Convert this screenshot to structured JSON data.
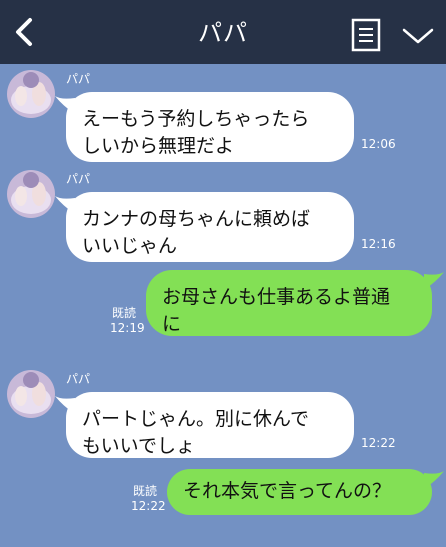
{
  "header": {
    "title": "パパ",
    "background": "#263146"
  },
  "colors": {
    "chat_background": "#7391c3",
    "incoming_bubble": "#ffffff",
    "outgoing_bubble": "#83e055"
  },
  "messages": [
    {
      "direction": "incoming",
      "sender": "パパ",
      "lines": [
        "えーもう予約しちゃったら",
        "しいから無理だよ"
      ],
      "time": "12:06"
    },
    {
      "direction": "incoming",
      "sender": "パパ",
      "lines": [
        "カンナの母ちゃんに頼めば",
        "いいじゃん"
      ],
      "time": "12:16"
    },
    {
      "direction": "outgoing",
      "lines": [
        "お母さんも仕事あるよ普通",
        "に"
      ],
      "read": "既読",
      "time": "12:19"
    },
    {
      "direction": "incoming",
      "sender": "パパ",
      "lines": [
        "パートじゃん。別に休んで",
        "もいいでしょ"
      ],
      "time": "12:22"
    },
    {
      "direction": "outgoing",
      "lines": [
        "それ本気で言ってんの？"
      ],
      "read": "既読",
      "time": "12:22"
    }
  ],
  "icons": {
    "back": "chevron-left-icon",
    "menu": "document-list-icon",
    "collapse": "chevron-down-icon"
  }
}
